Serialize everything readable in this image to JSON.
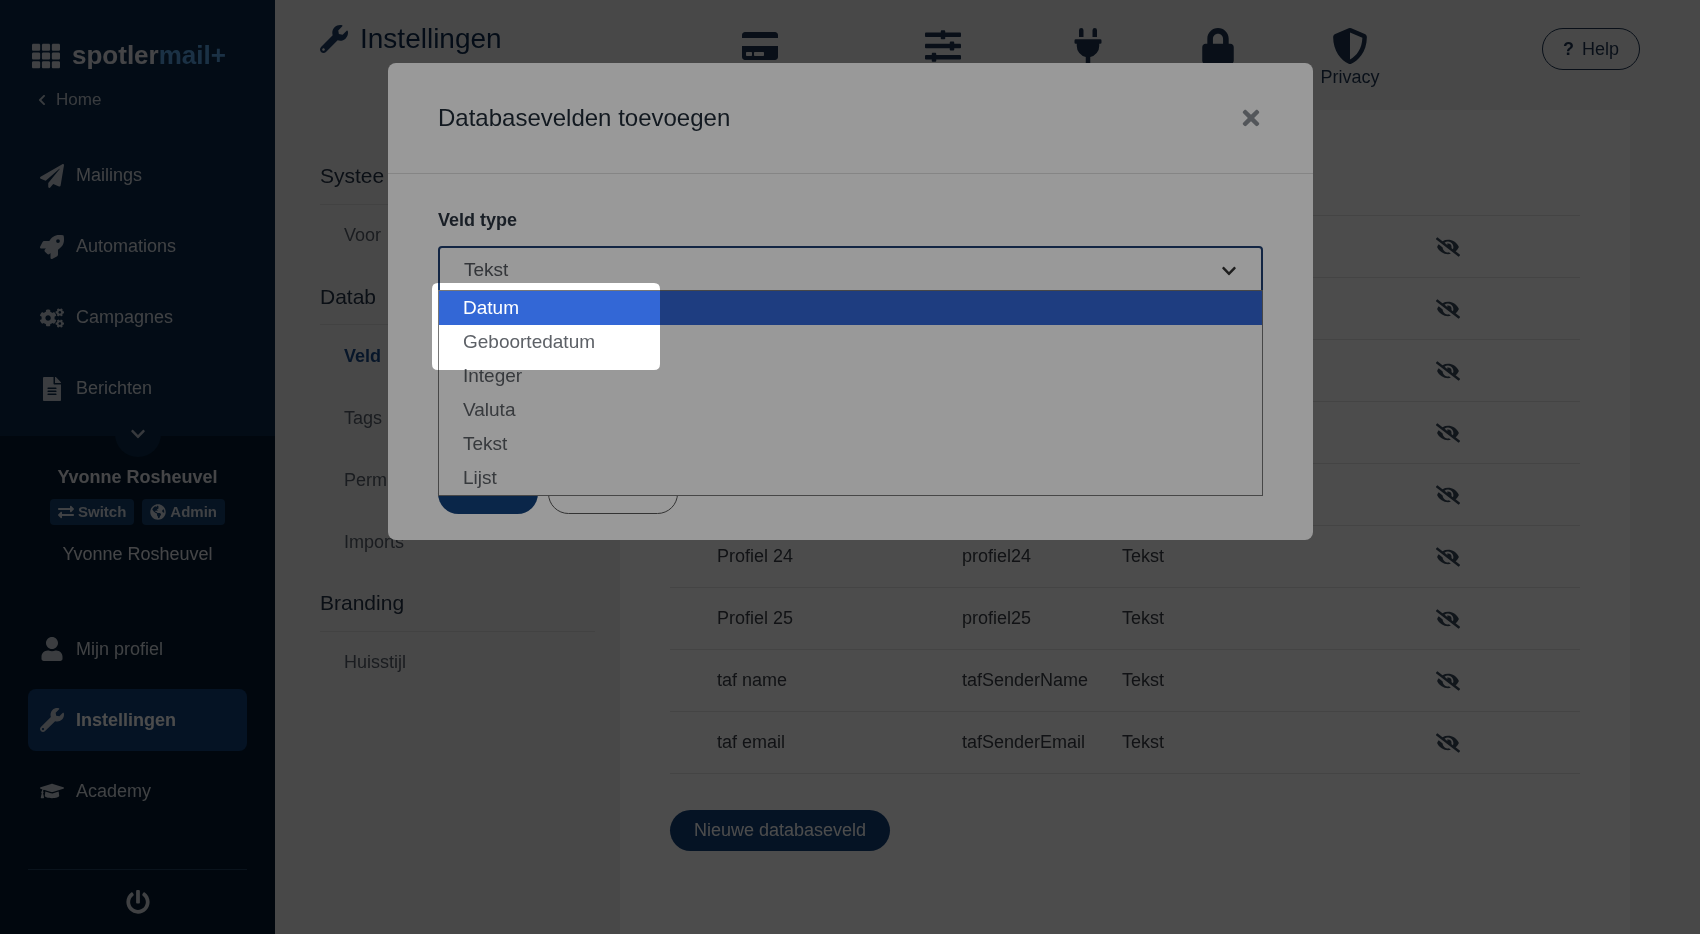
{
  "sidebar": {
    "brand": {
      "main": "spotler",
      "accent": "mail+"
    },
    "back_link": "Home",
    "items": [
      {
        "label": "Mailings",
        "selected": false
      },
      {
        "label": "Automations",
        "selected": false
      },
      {
        "label": "Campagnes",
        "selected": false
      },
      {
        "label": "Berichten",
        "selected": false
      }
    ],
    "user": {
      "name": "Yvonne Rosheuvel",
      "badges": [
        "Switch",
        "Admin"
      ],
      "account": "Yvonne Rosheuvel"
    },
    "bottom_items": [
      {
        "label": "Mijn profiel",
        "selected": false
      },
      {
        "label": "Instellingen",
        "selected": true
      },
      {
        "label": "Academy",
        "selected": false
      }
    ]
  },
  "header": {
    "title": "Instellingen",
    "privacy_label": "Privacy",
    "help": "Help",
    "help_icon": "?"
  },
  "settings_nav": [
    {
      "heading": "Systee",
      "items": [
        {
          "label": "Voor",
          "selected": false
        }
      ]
    },
    {
      "heading": "Datab",
      "items": [
        {
          "label": "Veld",
          "selected": true
        },
        {
          "label": "Tags",
          "selected": false
        },
        {
          "label": "Perm",
          "selected": false
        },
        {
          "label": "Imports",
          "selected": false
        }
      ]
    },
    {
      "heading": "Branding",
      "items": [
        {
          "label": "Huisstijl",
          "selected": false
        }
      ]
    }
  ],
  "table": {
    "rows": [
      {
        "visible": false
      },
      {
        "visible": false
      },
      {
        "visible": false
      },
      {
        "visible": false
      },
      {
        "visible": false
      },
      {
        "visible": false,
        "cells": [
          "Profiel 24",
          "profiel24",
          "Tekst"
        ]
      },
      {
        "visible": false,
        "cells": [
          "Profiel 25",
          "profiel25",
          "Tekst"
        ]
      },
      {
        "visible": false,
        "cells": [
          "taf name",
          "tafSenderName",
          "Tekst"
        ]
      },
      {
        "visible": false,
        "cells": [
          "taf email",
          "tafSenderEmail",
          "Tekst"
        ]
      }
    ]
  },
  "new_button": "Nieuwe databaseveld",
  "modal": {
    "title": "Databasevelden toevoegen",
    "field_label": "Veld type",
    "select_value": "Tekst",
    "options": [
      {
        "label": "Datum",
        "selected": true
      },
      {
        "label": "Geboortedatum",
        "selected": false
      },
      {
        "label": "Integer",
        "selected": false
      },
      {
        "label": "Valuta",
        "selected": false
      },
      {
        "label": "Tekst",
        "selected": false
      },
      {
        "label": "Lijst",
        "selected": false
      }
    ]
  }
}
